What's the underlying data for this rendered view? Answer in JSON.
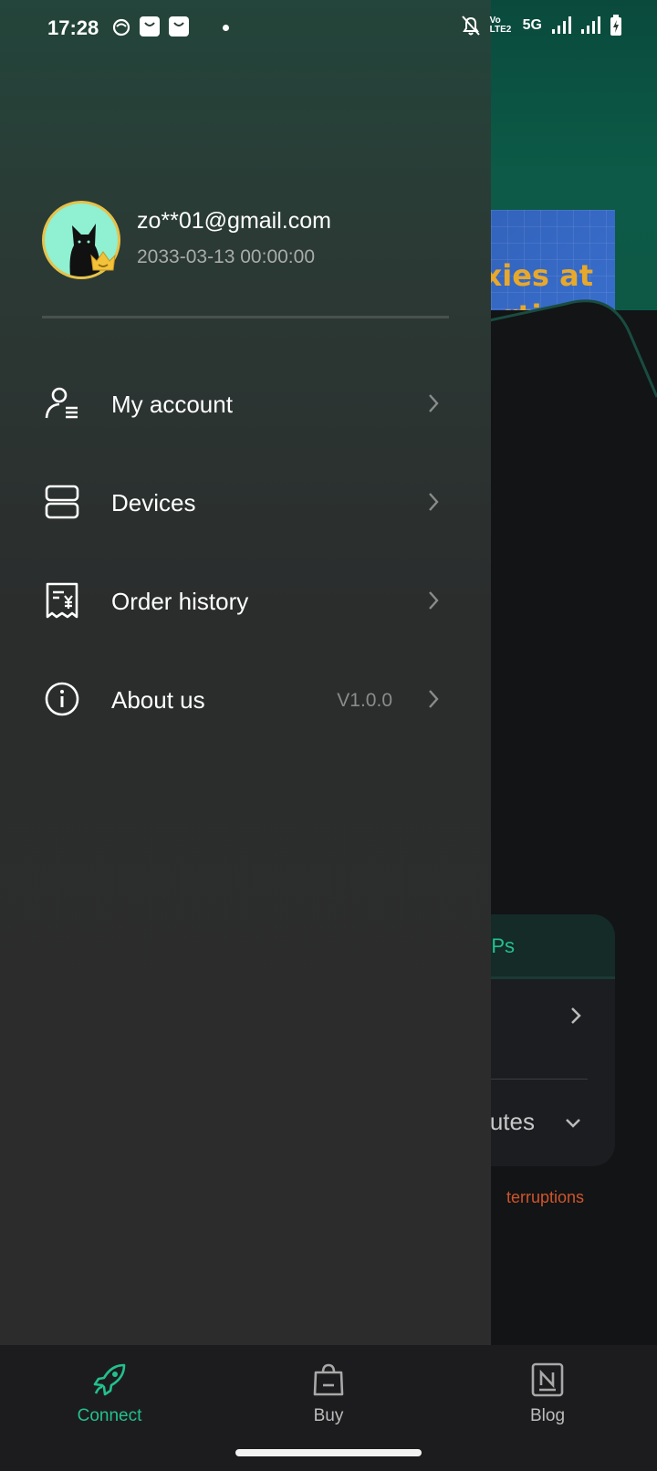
{
  "status_bar": {
    "time": "17:28",
    "network_5g": "5G",
    "volte_label": "Vo LTE2"
  },
  "background": {
    "banner_text": "oxies at\nrtips!",
    "card_header": "n IPs",
    "card_row2": "inutes",
    "warning": "terruptions"
  },
  "profile": {
    "email": "zo**01@gmail.com",
    "expiry": "2033-03-13 00:00:00"
  },
  "menu": [
    {
      "label": "My account",
      "icon": "user-list-icon",
      "value": ""
    },
    {
      "label": "Devices",
      "icon": "server-icon",
      "value": ""
    },
    {
      "label": "Order history",
      "icon": "receipt-yen-icon",
      "value": ""
    },
    {
      "label": "About us",
      "icon": "info-icon",
      "value": "V1.0.0"
    }
  ],
  "bottom_nav": [
    {
      "label": "Connect",
      "icon": "rocket-icon",
      "active": true
    },
    {
      "label": "Buy",
      "icon": "shopping-bag-icon",
      "active": false
    },
    {
      "label": "Blog",
      "icon": "notion-icon",
      "active": false
    }
  ],
  "colors": {
    "accent": "#23c08e",
    "avatar_border": "#e6c24a",
    "warning": "#d0552a"
  }
}
